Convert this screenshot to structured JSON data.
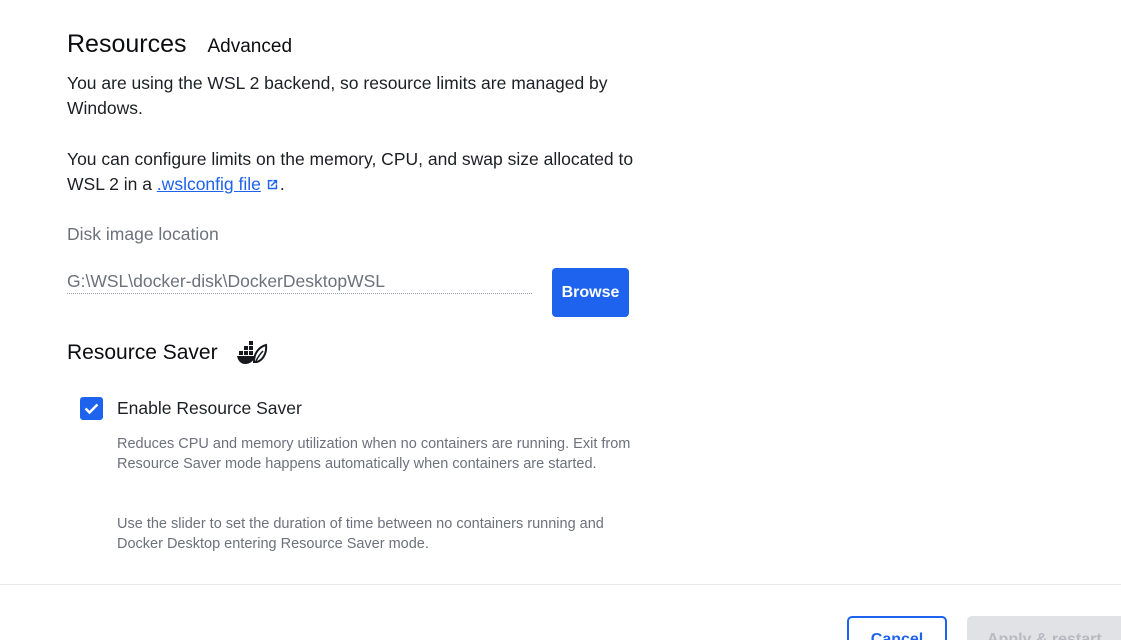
{
  "header": {
    "title": "Resources",
    "subtab": "Advanced"
  },
  "info": {
    "wsl_notice": "You are using the WSL 2 backend, so resource limits are managed by Windows.",
    "config_prefix": "You can configure limits on the memory, CPU, and swap size allocated to WSL 2 in a ",
    "config_link": ".wslconfig file",
    "config_suffix": "."
  },
  "disk": {
    "label": "Disk image location",
    "value": "G:\\WSL\\docker-disk\\DockerDesktopWSL",
    "browse_label": "Browse"
  },
  "resource_saver": {
    "title": "Resource Saver",
    "icon": "docker-leaf-icon",
    "enable_label": "Enable Resource Saver",
    "enabled": true,
    "desc1": "Reduces CPU and memory utilization when no containers are running. Exit from Resource Saver mode happens automatically when containers are started.",
    "desc2": "Use the slider to set the duration of time between no containers running and Docker Desktop entering Resource Saver mode."
  },
  "footer": {
    "cancel_label": "Cancel",
    "apply_label": "Apply & restart"
  },
  "colors": {
    "accent": "#1d63ed",
    "muted_text": "#6c717c",
    "disabled_bg": "#e1e2e6"
  }
}
